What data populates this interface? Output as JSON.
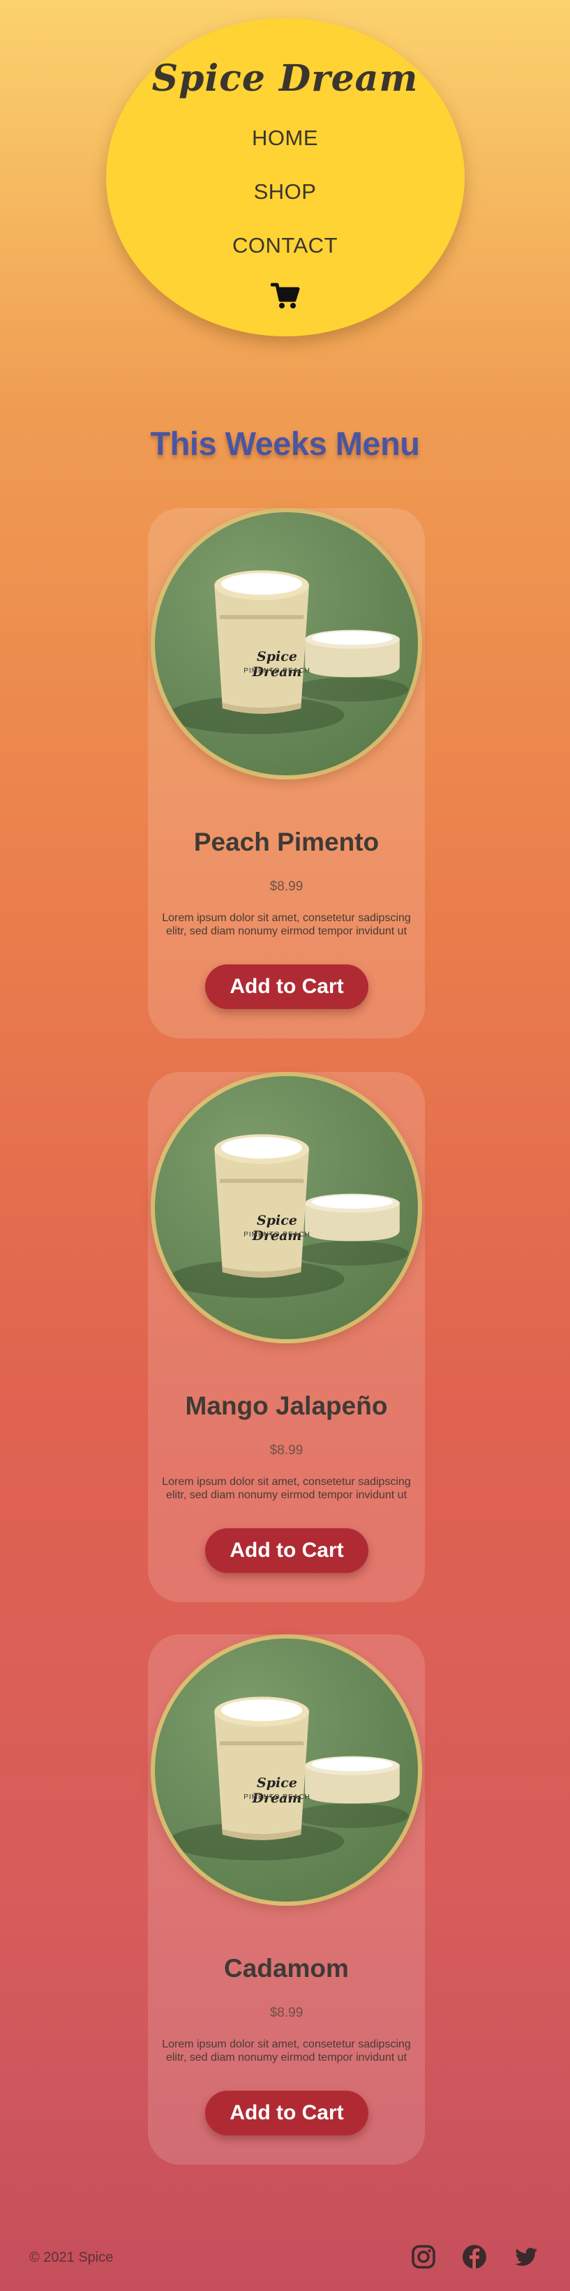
{
  "header": {
    "brand": "Spice Dream",
    "nav": [
      {
        "label": "HOME"
      },
      {
        "label": "SHOP"
      },
      {
        "label": "CONTACT"
      }
    ],
    "cart_icon": "shopping-cart-icon"
  },
  "menu": {
    "title": "This Weeks Menu",
    "items": [
      {
        "name": "Peach Pimento",
        "price": "$8.99",
        "description": "Lorem ipsum dolor sit amet, consetetur sadipscing elitr, sed diam nonumy eirmod tempor invidunt ut",
        "button": "Add to Cart",
        "product_label": "Spice Dream",
        "product_flavor": "PIMENTO PEACH"
      },
      {
        "name": "Mango Jalapeño",
        "price": "$8.99",
        "description": "Lorem ipsum dolor sit amet, consetetur sadipscing elitr, sed diam nonumy eirmod tempor invidunt ut",
        "button": "Add to Cart",
        "product_label": "Spice Dream",
        "product_flavor": "PIMENTO PEACH"
      },
      {
        "name": "Cadamom",
        "price": "$8.99",
        "description": "Lorem ipsum dolor sit amet, consetetur sadipscing elitr, sed diam nonumy eirmod tempor invidunt ut",
        "button": "Add to Cart",
        "product_label": "Spice Dream",
        "product_flavor": "PIMENTO PEACH"
      }
    ]
  },
  "footer": {
    "copyright": "© 2021 Spice",
    "social": [
      "instagram-icon",
      "facebook-icon",
      "twitter-icon"
    ]
  },
  "colors": {
    "header_blob": "#ffd333",
    "title": "#4a55a2",
    "button": "#b02a34"
  }
}
